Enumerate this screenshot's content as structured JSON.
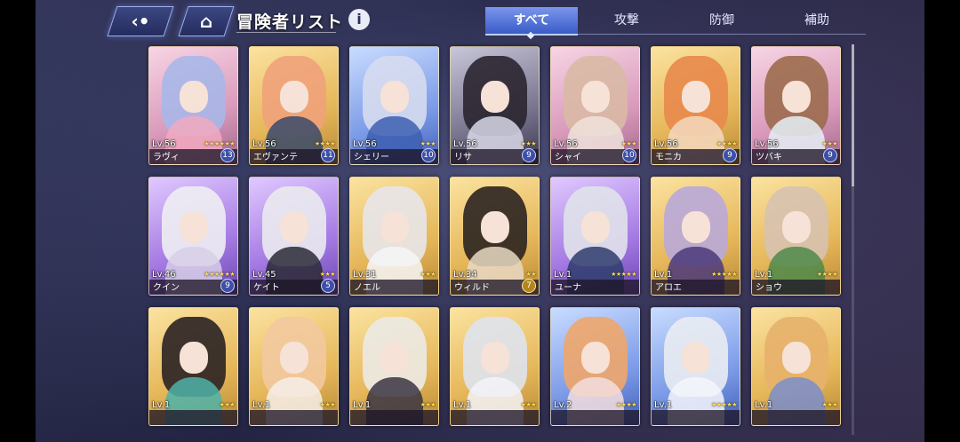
{
  "header": {
    "back_icon": "back-arrow-icon",
    "home_icon": "home-icon",
    "title": "冒険者リスト",
    "info_label": "i"
  },
  "tabs": [
    {
      "label": "すべて",
      "active": true
    },
    {
      "label": "攻撃",
      "active": false
    },
    {
      "label": "防御",
      "active": false
    },
    {
      "label": "補助",
      "active": false
    }
  ],
  "colors": {
    "accent_tab": "#5a78dc",
    "star": "#ffd94a",
    "badge_blue": "#3e4fa8",
    "badge_gold": "#b2851d"
  },
  "adventurers": [
    {
      "name": "ラヴィ",
      "level": "Lv.56",
      "stars": "★★★★★★",
      "badge": "13",
      "badge_style": "blue",
      "rarity": "pink",
      "hair": "#a9b7e8",
      "outfit": "#f2a9c0"
    },
    {
      "name": "エヴァンテ",
      "level": "Lv.56",
      "stars": "★★★★",
      "badge": "11",
      "badge_style": "blue",
      "rarity": "gold",
      "hair": "#f0a27a",
      "outfit": "#3a4a6a"
    },
    {
      "name": "シェリー",
      "level": "Lv.56",
      "stars": "★★★",
      "badge": "10",
      "badge_style": "blue",
      "rarity": "blue",
      "hair": "#d6dcef",
      "outfit": "#3d5fb2"
    },
    {
      "name": "リサ",
      "level": "Lv.56",
      "stars": "★★★",
      "badge": "9",
      "badge_style": "blue",
      "rarity": "dark",
      "hair": "#2a2530",
      "outfit": "#d8d8e8"
    },
    {
      "name": "シャイ",
      "level": "Lv.56",
      "stars": "★★★",
      "badge": "10",
      "badge_style": "blue",
      "rarity": "pink",
      "hair": "#d9b9a5",
      "outfit": "#efe3dc"
    },
    {
      "name": "モニカ",
      "level": "Lv.56",
      "stars": "★★★★",
      "badge": "9",
      "badge_style": "blue",
      "rarity": "gold",
      "hair": "#e88a4c",
      "outfit": "#f5d9c0"
    },
    {
      "name": "ツバキ",
      "level": "Lv.56",
      "stars": "★★★",
      "badge": "9",
      "badge_style": "blue",
      "rarity": "pink",
      "hair": "#9c6b4e",
      "outfit": "#e6f0f6"
    },
    {
      "name": "クイン",
      "level": "Lv.46",
      "stars": "★★★★★★",
      "badge": "9",
      "badge_style": "blue",
      "rarity": "purple",
      "hair": "#eeeef3",
      "outfit": "#d7cfe6"
    },
    {
      "name": "ケイト",
      "level": "Lv.45",
      "stars": "★★★",
      "badge": "5",
      "badge_style": "blue",
      "rarity": "purple",
      "hair": "#eaeaf0",
      "outfit": "#2a2a36"
    },
    {
      "name": "ノエル",
      "level": "Lv.31",
      "stars": "★★★",
      "badge": "",
      "badge_style": "none",
      "rarity": "gold",
      "hair": "#e8e6ea",
      "outfit": "#f6f6f8"
    },
    {
      "name": "ウィルド",
      "level": "Lv.34",
      "stars": "★★",
      "badge": "7",
      "badge_style": "gold",
      "rarity": "gold",
      "hair": "#2b2420",
      "outfit": "#e9d9c4"
    },
    {
      "name": "ユーナ",
      "level": "Lv.1",
      "stars": "★★★★★",
      "badge": "",
      "badge_style": "none",
      "rarity": "purple",
      "hair": "#e0e2ea",
      "outfit": "#2e3c6c"
    },
    {
      "name": "アロエ",
      "level": "Lv.1",
      "stars": "★★★★★",
      "badge": "",
      "badge_style": "none",
      "rarity": "gold",
      "hair": "#b9a9d9",
      "outfit": "#4b3a7a"
    },
    {
      "name": "ショウ",
      "level": "Lv.1",
      "stars": "★★★★",
      "badge": "",
      "badge_style": "none",
      "rarity": "gold",
      "hair": "#d7c2b0",
      "outfit": "#4e8a4a"
    },
    {
      "name": "",
      "level": "Lv.1",
      "stars": "★★★",
      "badge": "",
      "badge_style": "none",
      "rarity": "gold",
      "hair": "#2a2224",
      "outfit": "#4fb3a8"
    },
    {
      "name": "",
      "level": "Lv.1",
      "stars": "★★★",
      "badge": "",
      "badge_style": "none",
      "rarity": "gold",
      "hair": "#f2c99e",
      "outfit": "#f4efe8"
    },
    {
      "name": "",
      "level": "Lv.1",
      "stars": "★★★",
      "badge": "",
      "badge_style": "none",
      "rarity": "gold",
      "hair": "#eceae6",
      "outfit": "#3a3542"
    },
    {
      "name": "",
      "level": "Lv.1",
      "stars": "★★★",
      "badge": "",
      "badge_style": "none",
      "rarity": "gold",
      "hair": "#dfe3ee",
      "outfit": "#f3f3f8"
    },
    {
      "name": "",
      "level": "Lv.2",
      "stars": "★★★★",
      "badge": "",
      "badge_style": "none",
      "rarity": "blue",
      "hair": "#f0a66a",
      "outfit": "#f3dede"
    },
    {
      "name": "",
      "level": "Lv.1",
      "stars": "★★★★★",
      "badge": "",
      "badge_style": "none",
      "rarity": "blue",
      "hair": "#e9ecf2",
      "outfit": "#f4f6fb"
    },
    {
      "name": "",
      "level": "Lv.1",
      "stars": "★★★",
      "badge": "",
      "badge_style": "none",
      "rarity": "gold",
      "hair": "#e7b16c",
      "outfit": "#7a8ecb"
    }
  ]
}
